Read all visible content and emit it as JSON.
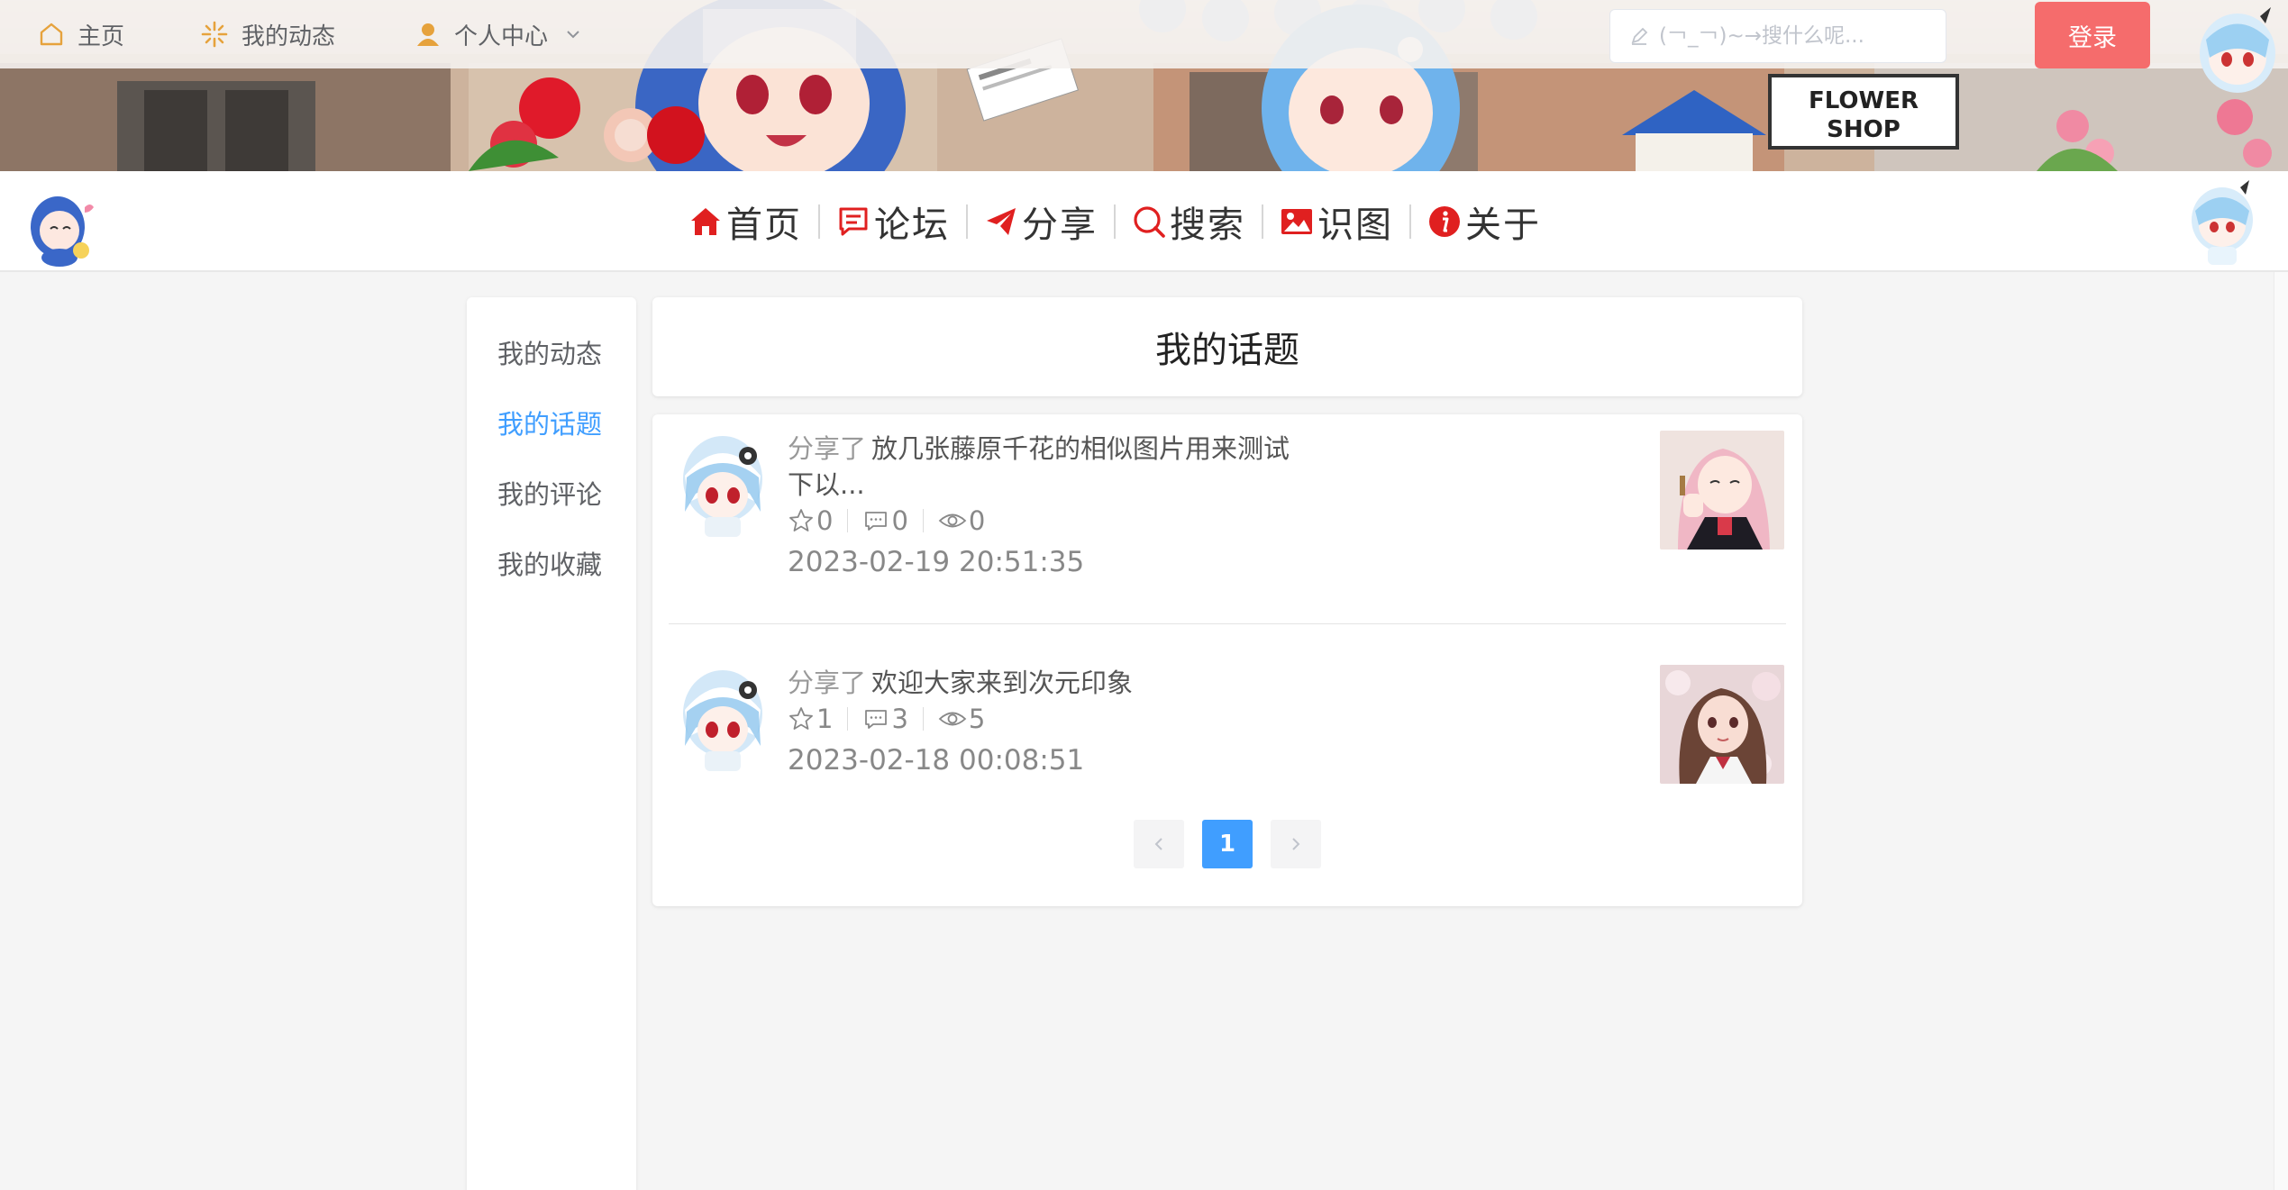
{
  "topbar": {
    "home_label": "主页",
    "dynamics_label": "我的动态",
    "user_center_label": "个人中心",
    "search_placeholder": "(￢_￢)~→搜什么呢...",
    "login_label": "登录"
  },
  "banner": {
    "sign_line1": "FLOWER",
    "sign_line2": "SHOP"
  },
  "nav": {
    "items": [
      {
        "label": "首页",
        "icon": "home-icon"
      },
      {
        "label": "论坛",
        "icon": "chat-icon"
      },
      {
        "label": "分享",
        "icon": "paper-plane-icon"
      },
      {
        "label": "搜索",
        "icon": "search-icon"
      },
      {
        "label": "识图",
        "icon": "image-icon"
      },
      {
        "label": "关于",
        "icon": "info-icon"
      }
    ],
    "accent_color": "#e02020"
  },
  "sidebar": {
    "items": [
      {
        "label": "我的动态"
      },
      {
        "label": "我的话题"
      },
      {
        "label": "我的评论"
      },
      {
        "label": "我的收藏"
      }
    ],
    "active_index": 1,
    "active_color": "#409eff"
  },
  "main": {
    "title": "我的话题",
    "posts": [
      {
        "verb": "分享了",
        "title": "放几张藤原千花的相似图片用来测试下以...",
        "stars": "0",
        "comments": "0",
        "views": "0",
        "time": "2023-02-19 20:51:35"
      },
      {
        "verb": "分享了",
        "title": "欢迎大家来到次元印象",
        "stars": "1",
        "comments": "3",
        "views": "5",
        "time": "2023-02-18 00:08:51"
      }
    ],
    "pagination": {
      "current": "1",
      "prev_icon": "chevron-left-icon",
      "next_icon": "chevron-right-icon"
    }
  },
  "colors": {
    "login_button": "#f56c6c",
    "pagination_active": "#409eff"
  }
}
